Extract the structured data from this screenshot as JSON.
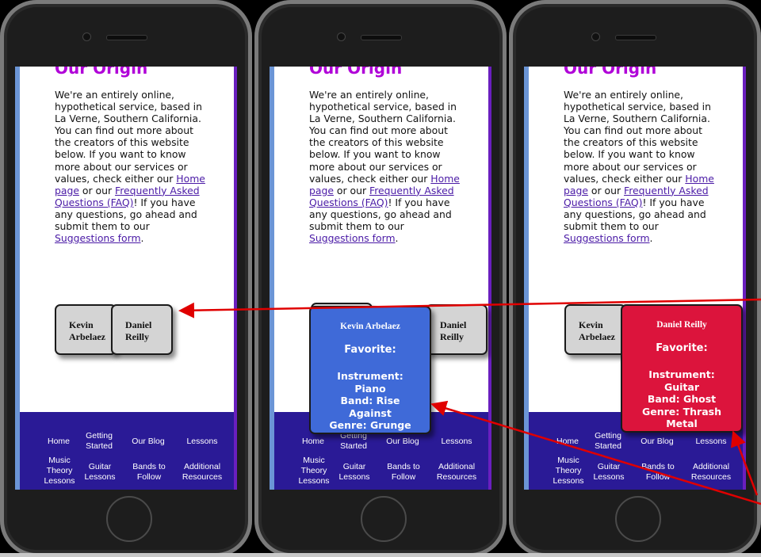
{
  "heading": "Our Origin",
  "paragraph": {
    "text1": "We're an entirely online, hypothetical service, based in La Verne, Southern California. You can find out more about the creators of this website below. If you want to know more about our services or values, check either our ",
    "link_home": "Home page",
    "text2": " or our ",
    "link_faq": "Frequently Asked Questions (FAQ)",
    "text3": "! If you have any questions, go ahead and submit them to our ",
    "link_suggestions": "Suggestions form",
    "text4": "."
  },
  "cards": {
    "kevin": "Kevin Arbelaez",
    "daniel": "Daniel Reilly"
  },
  "popups": {
    "kevin": {
      "title": "Kevin Arbelaez",
      "favorite": "Favorite:",
      "line1": "Instrument:",
      "line2": "Piano",
      "line3": "Band: Rise",
      "line4": "Against",
      "line5": "Genre: Grunge"
    },
    "daniel": {
      "title": "Daniel Reilly",
      "favorite": "Favorite:",
      "line1": "Instrument:",
      "line2": "Guitar",
      "line3": "Band: Ghost",
      "line4": "Genre: Thrash",
      "line5": "Metal"
    }
  },
  "nav": {
    "home": "Home",
    "getting_started": "Getting Started",
    "blog": "Our Blog",
    "lessons": "Lessons",
    "music_theory": "Music Theory Lessons",
    "guitar_lessons": "Guitar Lessons",
    "bands": "Bands to Follow",
    "resources": "Additional Resources"
  },
  "colors": {
    "heading": "#b000d8",
    "footer": "#2a1a96",
    "popup_kevin": "#3f6ad8",
    "popup_daniel": "#dc143c",
    "arrow": "#e00000"
  }
}
